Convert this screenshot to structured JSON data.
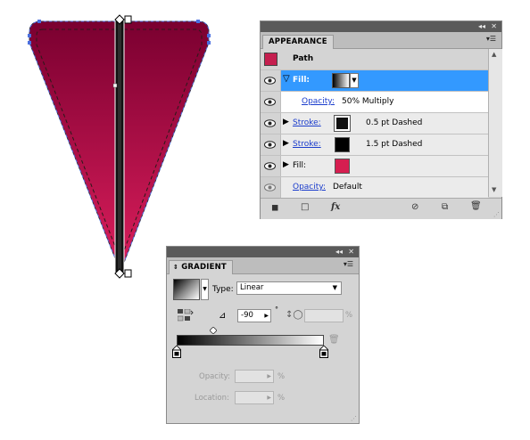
{
  "appearance": {
    "title": "APPEARANCE",
    "object_label": "Path",
    "object_swatch_color": "#c51f4f",
    "fill_label": "Fill:",
    "opacity_label": "Opacity:",
    "opacity_value": "50% Multiply",
    "stroke_label": "Stroke:",
    "stroke1_value": "0.5 pt Dashed",
    "stroke2_value": "1.5 pt Dashed",
    "fill2_label": "Fill:",
    "fill2_color": "#d61e50",
    "opacity2_label": "Opacity:",
    "opacity2_value": "Default",
    "fx_label": "fx"
  },
  "gradient": {
    "title": "GRADIENT",
    "type_label": "Type:",
    "type_value": "Linear",
    "angle_value": "-90",
    "degree_symbol": "°",
    "percent_symbol": "%",
    "opacity_label": "Opacity:",
    "location_label": "Location:",
    "start_color": "#000000",
    "end_color": "#ffffff"
  },
  "colors": {
    "shape_top": "#7a0030",
    "shape_bottom": "#dc1e5c",
    "selection": "#4a6fe0",
    "highlight": "#3399ff"
  }
}
